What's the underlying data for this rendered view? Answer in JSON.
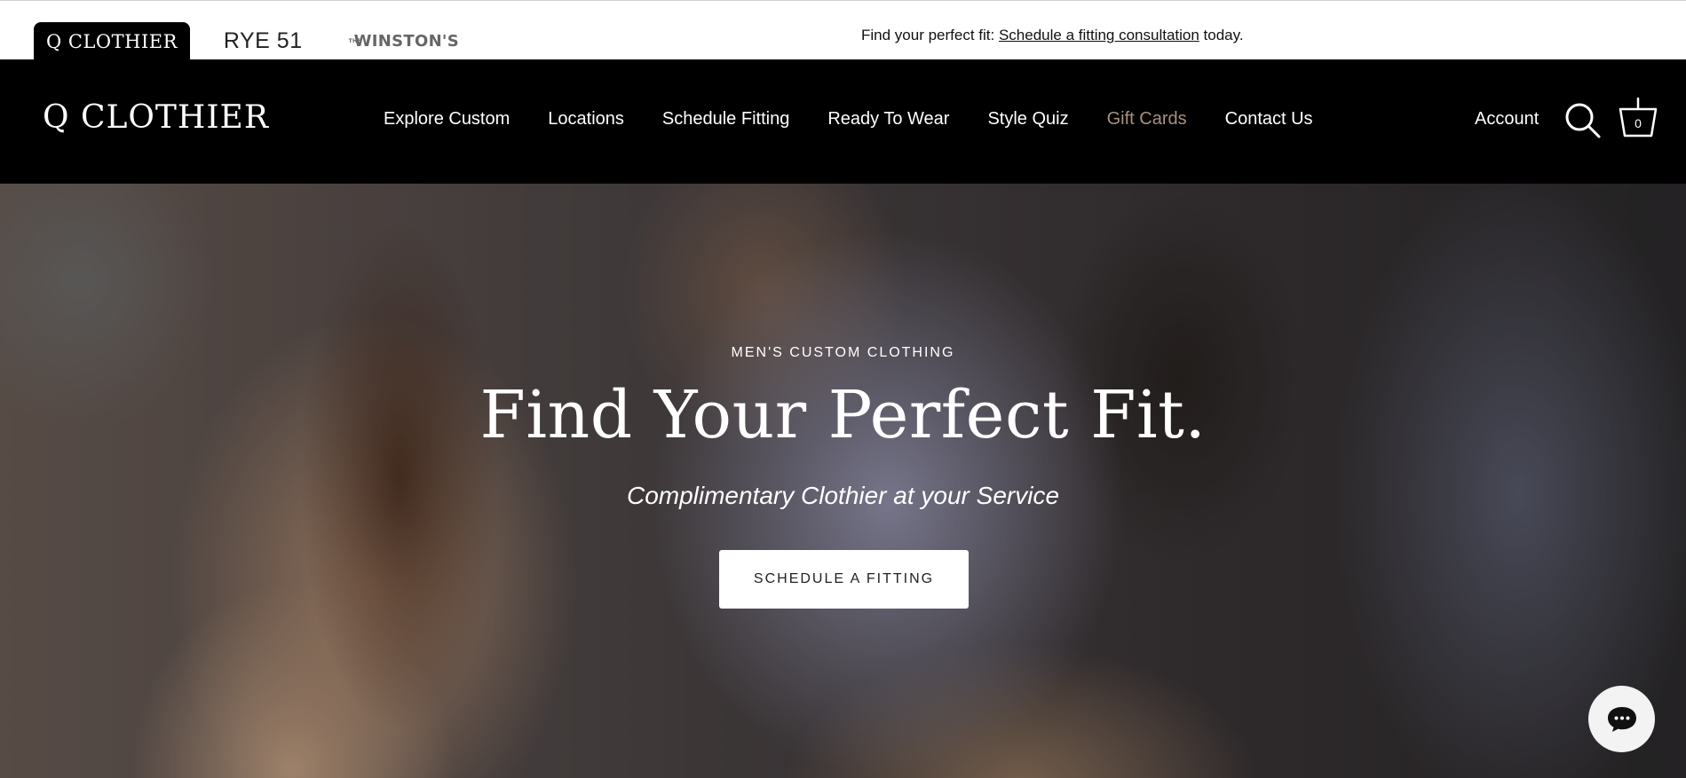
{
  "topbar": {
    "brand_tabs": [
      {
        "label": "Q CLOTHIER",
        "active": true
      },
      {
        "label": "RYE 51",
        "active": false
      },
      {
        "label_prefix": "THE",
        "label": "WINSTON'S",
        "active": false
      }
    ],
    "announcement": {
      "before": "Find your perfect fit: ",
      "link": "Schedule a fitting consultation",
      "after": " today."
    }
  },
  "header": {
    "logo": "Q CLOTHIER",
    "nav": [
      {
        "label": "Explore Custom"
      },
      {
        "label": "Locations"
      },
      {
        "label": "Schedule Fitting"
      },
      {
        "label": "Ready To Wear"
      },
      {
        "label": "Style Quiz"
      },
      {
        "label": "Gift Cards",
        "accent": "#a8917c"
      },
      {
        "label": "Contact Us"
      }
    ],
    "account": "Account",
    "search_icon": "search-icon",
    "cart_icon": "basket-icon",
    "cart_count": "0"
  },
  "hero": {
    "eyebrow": "MEN'S CUSTOM CLOTHING",
    "headline": "Find Your Perfect Fit.",
    "subhead": "Complimentary Clothier at your Service",
    "cta": "SCHEDULE A FITTING"
  },
  "chat": {
    "icon": "chat-bubble-icon"
  },
  "colors": {
    "header_bg": "#000000",
    "topbar_bg": "#ffffff",
    "accent": "#a8917c",
    "cta_bg": "#ffffff"
  }
}
